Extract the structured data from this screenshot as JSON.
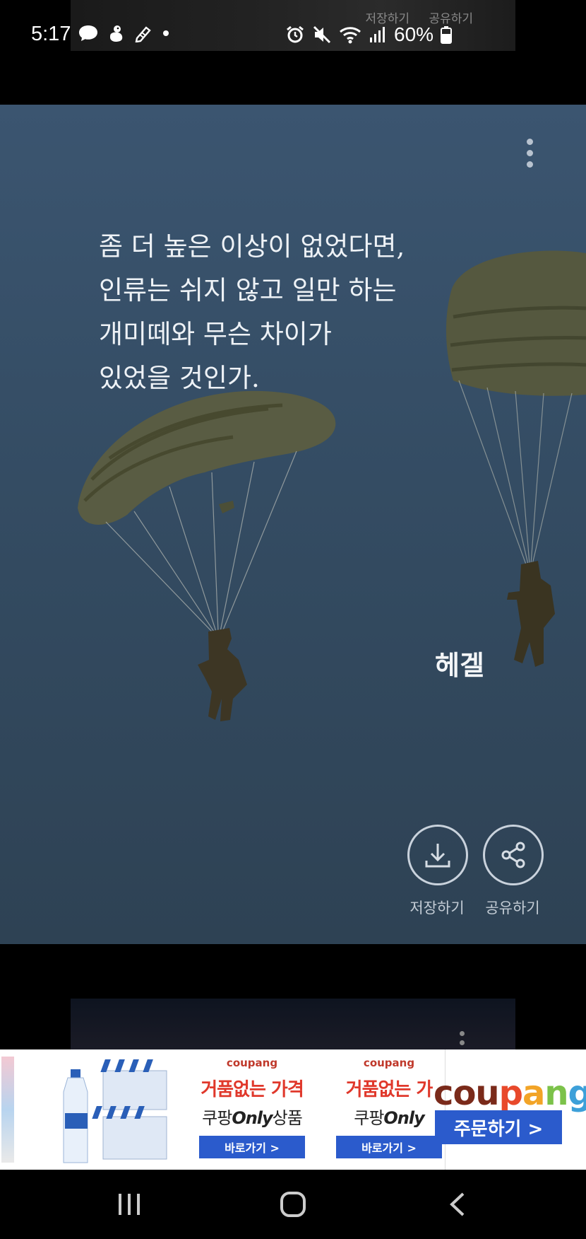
{
  "status_bar": {
    "time": "5:17",
    "battery_percent": "60%",
    "notification_icons": [
      "chat-bubble-icon",
      "duck-app-icon",
      "pencil-app-icon",
      "more-notifications-dot-icon"
    ],
    "system_icons": [
      "alarm-icon",
      "mute-icon",
      "wifi-icon",
      "signal-icon",
      "battery-icon"
    ]
  },
  "previous_card": {
    "save_label": "저장하기",
    "share_label": "공유하기"
  },
  "quote_card": {
    "quote": "좀 더 높은 이상이 없었다면,\n 인류는 쉬지 않고 일만 하는\n 개미떼와 무슨 차이가\n 있었을 것인가.",
    "author": "헤겔",
    "save_label": "저장하기",
    "share_label": "공유하기",
    "background_color": "#3b5570"
  },
  "ad_banner": {
    "brand": "coupang",
    "headline": "거품없는 가격",
    "headline_cut": "거품없는 가",
    "sub_prefix": "쿠팡",
    "sub_only": "Only",
    "sub_suffix": "상품",
    "cta": "바로가기 >",
    "order_cta": "주문하기 >",
    "accent_color": "#2b5bcc",
    "headline_color": "#e0382b"
  },
  "nav_bar": {
    "buttons": [
      "recent-apps",
      "home",
      "back"
    ]
  }
}
